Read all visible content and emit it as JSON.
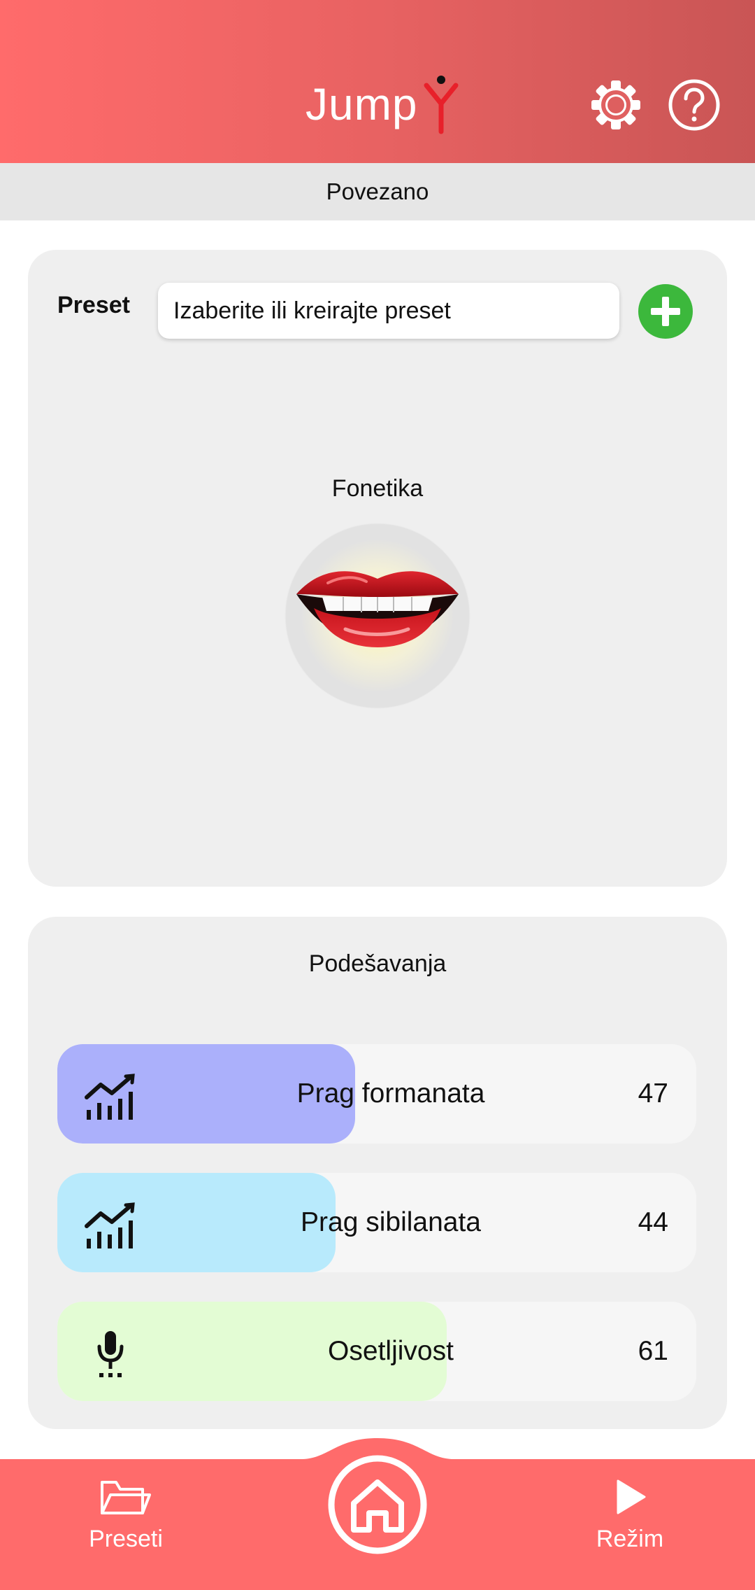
{
  "header": {
    "logo_text": "Jump",
    "settings_icon": "gear-icon",
    "help_icon": "question-circle-icon"
  },
  "status": {
    "text": "Povezano"
  },
  "preset": {
    "label": "Preset",
    "input_value": "",
    "input_placeholder": "Izaberite ili kreirajte preset",
    "add_icon": "plus-circle-icon"
  },
  "phonetics": {
    "title": "Fonetika",
    "image_icon": "lips-icon"
  },
  "settings": {
    "title": "Podešavanja",
    "sliders": [
      {
        "label": "Prag formanata",
        "value": "47",
        "icon": "chart-bars-icon",
        "color": "#abb0fb"
      },
      {
        "label": "Prag sibilanata",
        "value": "44",
        "icon": "chart-bars-icon",
        "color": "#b8eafc"
      },
      {
        "label": "Osetljivost",
        "value": "61",
        "icon": "microphone-icon",
        "color": "#e3fcd4"
      }
    ]
  },
  "nav": {
    "presets_label": "Preseti",
    "mode_label": "Režim",
    "home_icon": "home-icon"
  },
  "colors": {
    "header_start": "#ff6b6b",
    "header_end": "#c95555",
    "nav_bg": "#ff6b6b",
    "add_button": "#3cb83c",
    "status_bg": "#e6e6e6",
    "card_bg": "#efefef"
  }
}
